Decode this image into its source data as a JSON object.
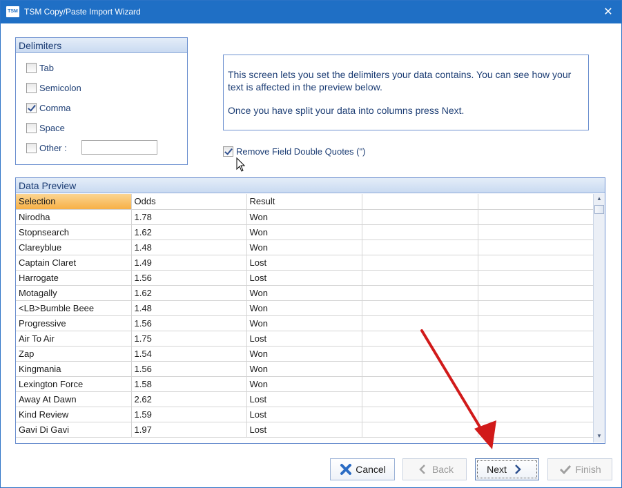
{
  "window": {
    "title": "TSM Copy/Paste Import Wizard",
    "icon_text": "TSM",
    "close_glyph": "✕"
  },
  "delimiters": {
    "header": "Delimiters",
    "options": [
      {
        "label": "Tab",
        "checked": false
      },
      {
        "label": "Semicolon",
        "checked": false
      },
      {
        "label": "Comma",
        "checked": true
      },
      {
        "label": "Space",
        "checked": false
      },
      {
        "label": "Other :",
        "checked": false
      }
    ],
    "other_value": ""
  },
  "info": {
    "line1": "This screen lets you set the delimiters your data contains. You can see how your text is affected in the preview below.",
    "line2": "Once you have split your data into columns press Next."
  },
  "remove_quotes": {
    "label": "Remove Field Double Quotes (\")",
    "checked": true
  },
  "preview": {
    "header": "Data Preview",
    "columns": [
      "Selection",
      "Odds",
      "Result",
      "",
      ""
    ],
    "rows": [
      [
        "Nirodha",
        "1.78",
        "Won"
      ],
      [
        "Stopnsearch",
        "1.62",
        "Won"
      ],
      [
        "Clareyblue",
        "1.48",
        "Won"
      ],
      [
        "Captain Claret",
        "1.49",
        "Lost"
      ],
      [
        "Harrogate",
        "1.56",
        "Lost"
      ],
      [
        "Motagally",
        "1.62",
        "Won"
      ],
      [
        "<LB>Bumble Beee",
        "1.48",
        "Won"
      ],
      [
        "Progressive",
        "1.56",
        "Won"
      ],
      [
        "Air To Air",
        "1.75",
        "Lost"
      ],
      [
        "Zap",
        "1.54",
        "Won"
      ],
      [
        "Kingmania",
        "1.56",
        "Won"
      ],
      [
        "Lexington Force",
        "1.58",
        "Won"
      ],
      [
        "Away At Dawn",
        "2.62",
        "Lost"
      ],
      [
        "Kind Review",
        "1.59",
        "Lost"
      ],
      [
        "Gavi Di Gavi",
        "1.97",
        "Lost"
      ]
    ]
  },
  "buttons": {
    "cancel": "Cancel",
    "back": "Back",
    "next": "Next",
    "finish": "Finish"
  },
  "colors": {
    "titlebar": "#1f6fc5",
    "header_text": "#1c3d74",
    "cancel_icon": "#2b6cc4",
    "arrow": "#d11a1a"
  }
}
